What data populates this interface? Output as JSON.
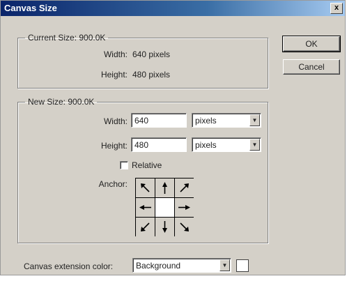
{
  "window": {
    "title": "Canvas Size",
    "close_glyph": "x"
  },
  "current_size": {
    "legend": "Current Size: 900.0K",
    "width_label": "Width:",
    "width_value": "640 pixels",
    "height_label": "Height:",
    "height_value": "480 pixels"
  },
  "new_size": {
    "legend": "New Size: 900.0K",
    "width_label": "Width:",
    "width_value": "640",
    "width_unit": "pixels",
    "height_label": "Height:",
    "height_value": "480",
    "height_unit": "pixels",
    "relative_label": "Relative",
    "relative_checked": false,
    "anchor_label": "Anchor:",
    "anchor_selected": "center",
    "anchor_icons": [
      "arrow-up-left-icon",
      "arrow-up-icon",
      "arrow-up-right-icon",
      "arrow-left-icon",
      "",
      "arrow-right-icon",
      "arrow-down-left-icon",
      "arrow-down-icon",
      "arrow-down-right-icon"
    ]
  },
  "extension": {
    "label": "Canvas extension color:",
    "value": "Background",
    "swatch_color": "#ffffff"
  },
  "buttons": {
    "ok": "OK",
    "cancel": "Cancel"
  }
}
